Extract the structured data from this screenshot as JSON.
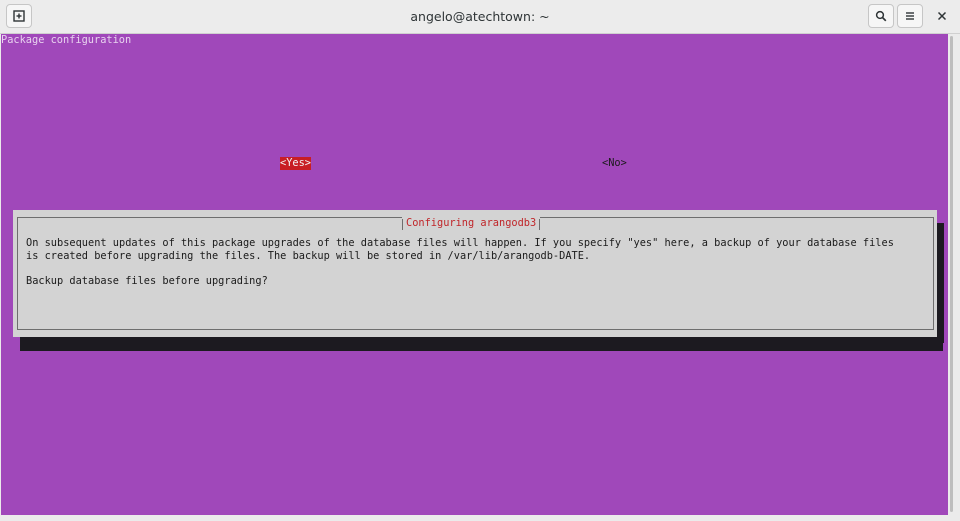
{
  "window": {
    "title": "angelo@atechtown: ~"
  },
  "terminal": {
    "header": "Package configuration",
    "background_color": "#a048ba"
  },
  "dialog": {
    "title": "Configuring arangodb3",
    "lines": [
      "On subsequent updates of this package upgrades of the database files will happen. If you specify \"yes\" here, a backup of your database files",
      "is created before upgrading the files. The backup will be stored in /var/lib/arangodb-DATE."
    ],
    "question": "Backup database files before upgrading?",
    "yes_label": "<Yes>",
    "no_label": "<No>",
    "selected_color": "#c81e24"
  },
  "icons": {
    "new_tab": "new-tab-icon",
    "search": "search-icon",
    "menu": "hamburger-menu-icon",
    "close": "close-icon"
  }
}
